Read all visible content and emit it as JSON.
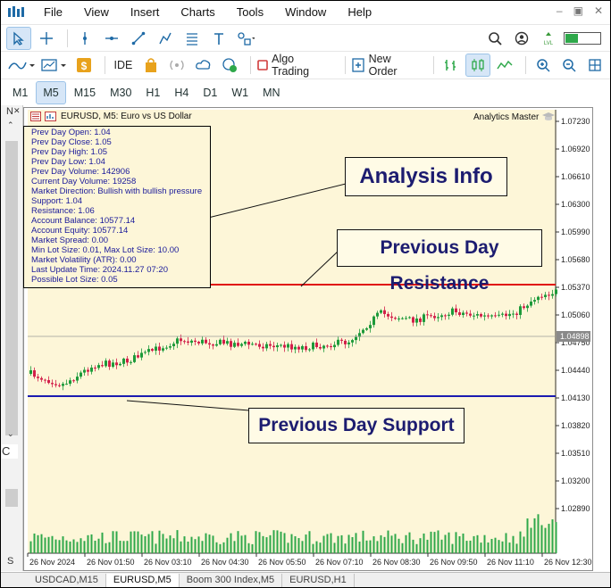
{
  "menu": {
    "items": [
      "File",
      "View",
      "Insert",
      "Charts",
      "Tools",
      "Window",
      "Help"
    ]
  },
  "toolbar2": {
    "ide_label": "IDE",
    "algo_label": "Algo Trading",
    "order_label": "New Order"
  },
  "timeframes": [
    "M1",
    "M5",
    "M15",
    "M30",
    "H1",
    "H4",
    "D1",
    "W1",
    "MN"
  ],
  "timeframe_selected": "M5",
  "chart": {
    "symbol_title": "EURUSD, M5:  Euro vs US Dollar",
    "indicator_name": "Analytics Master",
    "current_price_label": "1.04898",
    "price_axis": [
      "1.07230",
      "1.06920",
      "1.06610",
      "1.06300",
      "1.05990",
      "1.05680",
      "1.05370",
      "1.05060",
      "1.04750",
      "1.04440",
      "1.04130",
      "1.03820",
      "1.03510",
      "1.03200",
      "1.02890"
    ],
    "time_axis": [
      "26 Nov 2024",
      "26 Nov 01:50",
      "26 Nov 03:10",
      "26 Nov 04:30",
      "26 Nov 05:50",
      "26 Nov 07:10",
      "26 Nov 08:30",
      "26 Nov 09:50",
      "26 Nov 11:10",
      "26 Nov 12:30"
    ],
    "resistance_color": "#e01010",
    "support_color": "#1a1ab0"
  },
  "info": {
    "lines": [
      "Prev Day Open: 1.04",
      "Prev Day Close: 1.05",
      "Prev Day High: 1.05",
      "Prev Day Low: 1.04",
      "Prev Day Volume: 142906",
      "Current Day Volume: 19258",
      "Market Direction: Bullish with bullish pressure",
      "Support: 1.04",
      "Resistance: 1.06",
      "Account Balance: 10577.14",
      "Account Equity: 10577.14",
      "Market Spread: 0.00",
      "Min Lot Size: 0.01, Max Lot Size: 10.00",
      "Market Volatility (ATR): 0.00",
      "Last Update Time: 2024.11.27 07:20",
      "Possible Lot Size: 0.05"
    ]
  },
  "callouts": {
    "analysis": "Analysis Info",
    "resistance": "Previous Day Resistance",
    "support": "Previous Day Support"
  },
  "tabs": [
    "USDCAD,M15",
    "EURUSD,M5",
    "Boom 300 Index,M5",
    "EURUSD,H1"
  ],
  "tab_active": "EURUSD,M5",
  "left_panel": {
    "top_text": "N",
    "bottom_text": "C",
    "bottom2_text": "S"
  }
}
